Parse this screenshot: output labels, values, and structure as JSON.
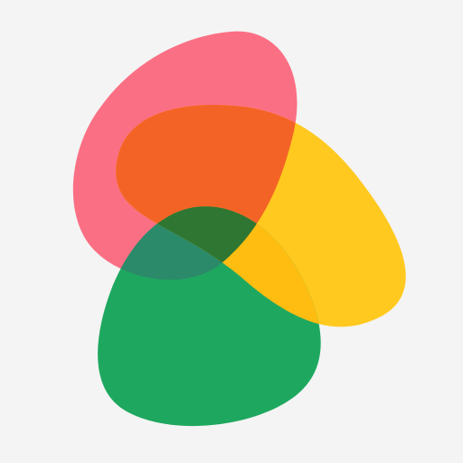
{
  "logo": {
    "shapes": [
      {
        "name": "pink-blob",
        "color": "#fb6f84"
      },
      {
        "name": "yellow-blob",
        "color": "#ffc91f"
      },
      {
        "name": "green-blob",
        "color": "#1ea85f"
      }
    ],
    "overlaps": [
      {
        "name": "pink-yellow-overlap",
        "color": "#f46326"
      },
      {
        "name": "pink-green-overlap",
        "color": "#2b8a69"
      },
      {
        "name": "yellow-green-overlap",
        "color": "#ffbd12"
      },
      {
        "name": "center-overlap",
        "color": "#2e7632"
      }
    ]
  }
}
